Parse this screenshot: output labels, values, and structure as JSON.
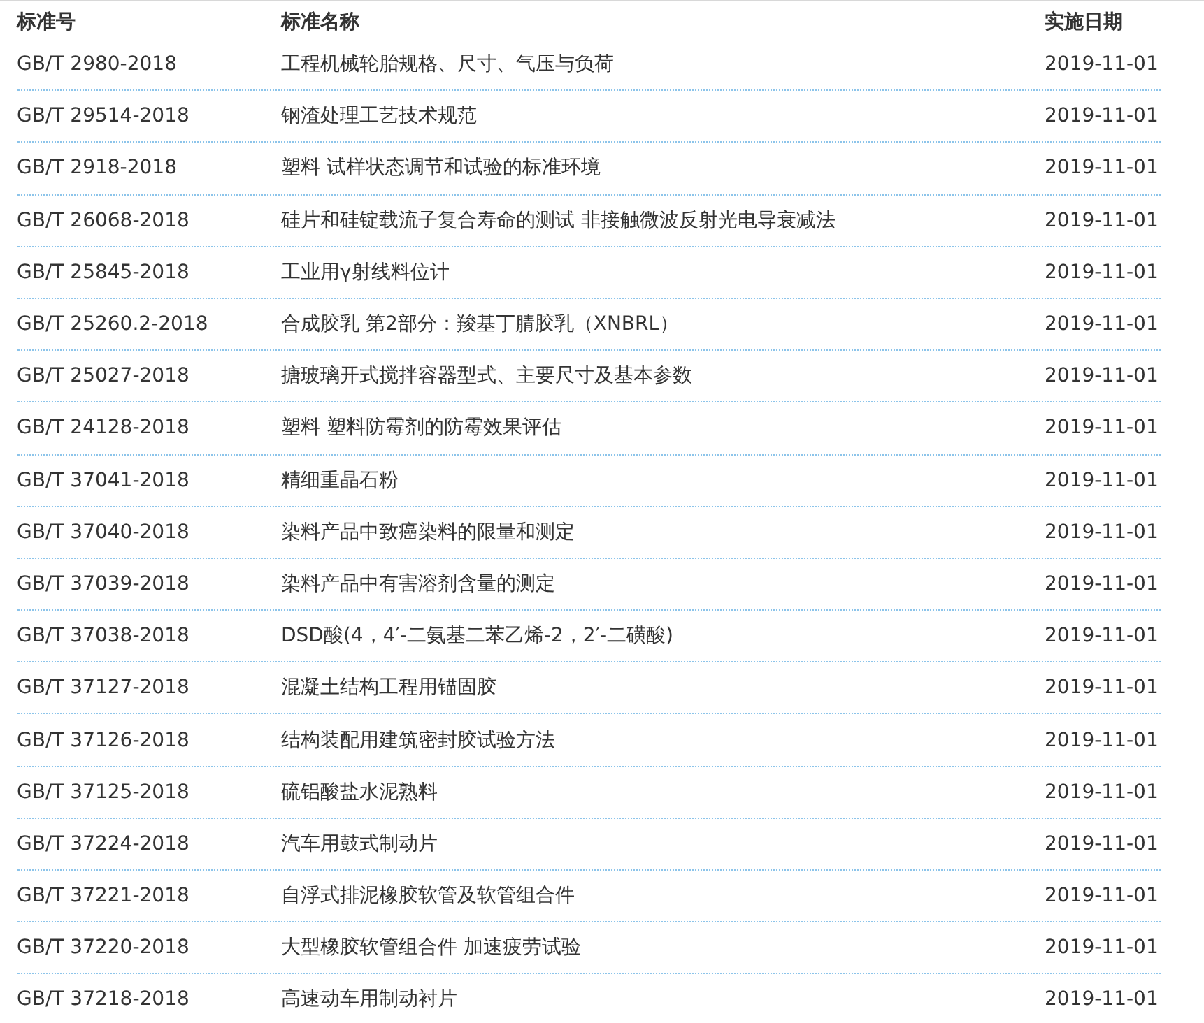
{
  "table": {
    "columns": [
      "标准号",
      "标准名称",
      "实施日期"
    ],
    "rows": [
      {
        "number": "GB/T 2980-2018",
        "name": "工程机械轮胎规格、尺寸、气压与负荷",
        "date": "2019-11-01"
      },
      {
        "number": "GB/T 29514-2018",
        "name": "钢渣处理工艺技术规范",
        "date": "2019-11-01"
      },
      {
        "number": "GB/T 2918-2018",
        "name": "塑料 试样状态调节和试验的标准环境",
        "date": "2019-11-01"
      },
      {
        "number": "GB/T 26068-2018",
        "name": "硅片和硅锭载流子复合寿命的测试 非接触微波反射光电导衰减法",
        "date": "2019-11-01"
      },
      {
        "number": "GB/T 25845-2018",
        "name": "工业用γ射线料位计",
        "date": "2019-11-01"
      },
      {
        "number": "GB/T 25260.2-2018",
        "name": "合成胶乳 第2部分：羧基丁腈胶乳（XNBRL）",
        "date": "2019-11-01"
      },
      {
        "number": "GB/T 25027-2018",
        "name": "搪玻璃开式搅拌容器型式、主要尺寸及基本参数",
        "date": "2019-11-01"
      },
      {
        "number": "GB/T 24128-2018",
        "name": "塑料 塑料防霉剂的防霉效果评估",
        "date": "2019-11-01"
      },
      {
        "number": "GB/T 37041-2018",
        "name": "精细重晶石粉",
        "date": "2019-11-01"
      },
      {
        "number": "GB/T 37040-2018",
        "name": "染料产品中致癌染料的限量和测定",
        "date": "2019-11-01"
      },
      {
        "number": "GB/T 37039-2018",
        "name": "染料产品中有害溶剂含量的测定",
        "date": "2019-11-01"
      },
      {
        "number": "GB/T 37038-2018",
        "name": "DSD酸(4，4′-二氨基二苯乙烯-2，2′-二磺酸)",
        "date": "2019-11-01"
      },
      {
        "number": "GB/T 37127-2018",
        "name": "混凝土结构工程用锚固胶",
        "date": "2019-11-01"
      },
      {
        "number": "GB/T 37126-2018",
        "name": "结构装配用建筑密封胶试验方法",
        "date": "2019-11-01"
      },
      {
        "number": "GB/T 37125-2018",
        "name": "硫铝酸盐水泥熟料",
        "date": "2019-11-01"
      },
      {
        "number": "GB/T 37224-2018",
        "name": "汽车用鼓式制动片",
        "date": "2019-11-01"
      },
      {
        "number": "GB/T 37221-2018",
        "name": "自浮式排泥橡胶软管及软管组合件",
        "date": "2019-11-01"
      },
      {
        "number": "GB/T 37220-2018",
        "name": "大型橡胶软管组合件 加速疲劳试验",
        "date": "2019-11-01"
      },
      {
        "number": "GB/T 37218-2018",
        "name": "高速动车用制动衬片",
        "date": "2019-11-01"
      }
    ]
  }
}
